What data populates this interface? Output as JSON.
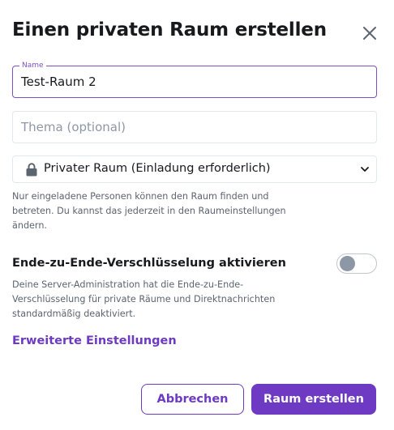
{
  "dialog": {
    "title": "Einen privaten Raum erstellen",
    "close_icon": "close-icon"
  },
  "name_field": {
    "label": "Name",
    "value": "Test-Raum 2"
  },
  "topic_field": {
    "placeholder": "Thema (optional)",
    "value": ""
  },
  "visibility_select": {
    "icon": "lock-icon",
    "selected": "Privater Raum (Einladung erforderlich)",
    "help_lines": [
      "Nur eingeladene Personen können den Raum finden und",
      "betreten. Du kannst das jederzeit in den Raumeinstellungen",
      "ändern."
    ]
  },
  "encryption": {
    "label": "Ende-zu-Ende-Verschlüsselung aktivieren",
    "enabled": false,
    "help_lines": [
      "Deine Server-Administration hat die Ende-zu-Ende-",
      "Verschlüsselung für private Räume und Direktnachrichten",
      "standardmäßig deaktiviert."
    ]
  },
  "advanced_link": "Erweiterte Einstellungen",
  "buttons": {
    "cancel": "Abbrechen",
    "create": "Raum erstellen"
  },
  "colors": {
    "accent": "#6e39c3",
    "focus_border": "#7f4fc9",
    "field_border": "#e3e8f0",
    "text": "#17191c",
    "muted_text": "#5c6470",
    "placeholder": "#8d97a5"
  }
}
